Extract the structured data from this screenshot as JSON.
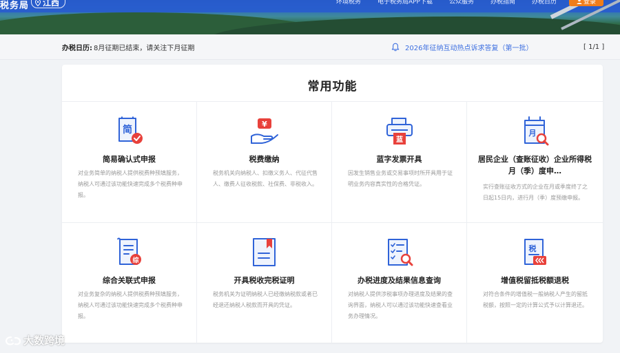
{
  "header": {
    "brand": "税务局",
    "region": "江西",
    "nav": [
      "环境税务",
      "电子税务局APP下载",
      "公众服务",
      "办税指南",
      "办税日历"
    ],
    "login_label": "登录"
  },
  "calendar": {
    "label": "办税日历:",
    "text": "8月征期已结束，请关注下月征期",
    "notice": "2026年征纳互动热点诉求答复（第一批）",
    "pager": "[ 1/1 ]"
  },
  "section": {
    "title": "常用功能",
    "tiles": [
      {
        "title": "简易确认式申报",
        "desc": "对业务简单的纳税人提供税费种预填服务，纳税人可通过该功能快速完成多个税费种申报。",
        "icon": "simple-declare-icon"
      },
      {
        "title": "税费缴纳",
        "desc": "税务机关向纳税人、扣缴义务人、代征代售人、缴费人征收税款、社保费、非税收入。",
        "icon": "tax-payment-icon"
      },
      {
        "title": "蓝字发票开具",
        "desc": "因发生销售业务或交易事项时所开具用于证明业务内容真实性的合格凭证。",
        "icon": "invoice-printer-icon"
      },
      {
        "title": "居民企业（查账征收）企业所得税月（季）度申…",
        "desc": "实行查账征收方式的企业在月或季度终了之日起15日内，进行月（季）度预缴申报。",
        "icon": "calendar-search-icon"
      },
      {
        "title": "综合关联式申报",
        "desc": "对业务复杂的纳税人提供税费种预填服务，纳税人可通过该功能快速完成多个税费种申报。",
        "icon": "comprehensive-declare-icon"
      },
      {
        "title": "开具税收完税证明",
        "desc": "税务机关为证明纳税人已经缴纳税款或者已经退还纳税人税款而开具的凭证。",
        "icon": "tax-certificate-icon"
      },
      {
        "title": "办税进度及结果信息查询",
        "desc": "对纳税人提供涉税事项办理进度及结果的查询界面，纳税人可以通过该功能快速查看业务办理情况。",
        "icon": "progress-query-icon"
      },
      {
        "title": "增值税留抵税额退税",
        "desc": "对符合条件的增值税一般纳税人产生的留抵税额，按照一定的计算公式予以计算退还。",
        "icon": "vat-refund-icon"
      }
    ]
  },
  "icon_glyphs": {
    "simple": "简",
    "payment": "¥",
    "blue": "蓝",
    "month": "月",
    "comprehensive": "综",
    "tax": "税"
  },
  "watermark": "大数跨境",
  "colors": {
    "accent_blue": "#3d6fe0",
    "accent_red": "#e8413b",
    "login_orange": "#f07d1a"
  }
}
